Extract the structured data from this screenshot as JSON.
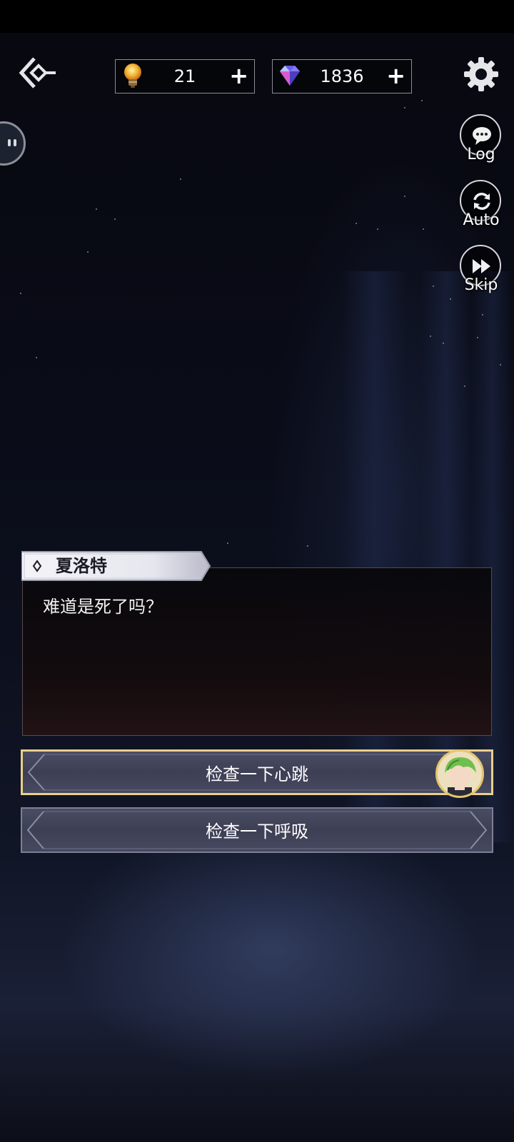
{
  "hud": {
    "bulbs": {
      "value": "21",
      "plus": "+",
      "icon": "lightbulb-icon"
    },
    "gems": {
      "value": "1836",
      "plus": "+",
      "icon": "diamond-icon"
    }
  },
  "side_buttons": [
    {
      "label": "Log",
      "icon": "chat-bubble-icon"
    },
    {
      "label": "Auto",
      "icon": "auto-cycle-icon"
    },
    {
      "label": "Skip",
      "icon": "fast-forward-icon"
    }
  ],
  "dialogue": {
    "speaker": "夏洛特",
    "text": "难道是死了吗？"
  },
  "choices": [
    {
      "label": "检查一下心跳",
      "selected": true
    },
    {
      "label": "检查一下呼吸",
      "selected": false
    }
  ],
  "colors": {
    "accent_gold": "#e9cf8b",
    "choice_bg": "#404258",
    "dialog_border": "#5a4a4a"
  }
}
